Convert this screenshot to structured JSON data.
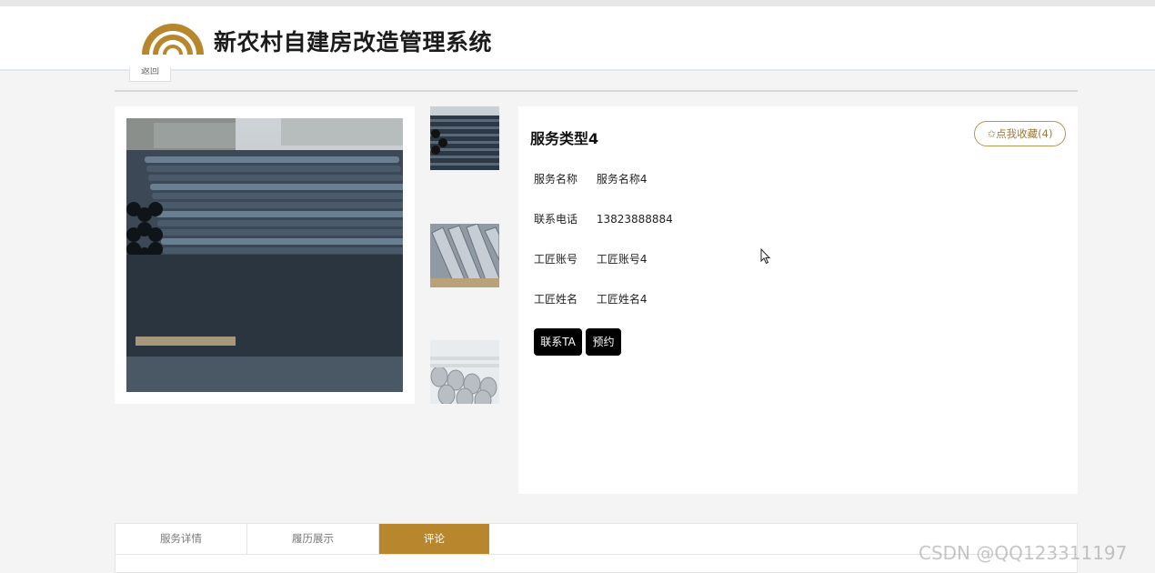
{
  "header": {
    "title": "新农村自建房改造管理系统",
    "logo_icon": "arch-logo-icon",
    "brand_color": "#b8872d"
  },
  "nav": {
    "back_label": "返回"
  },
  "gallery": {
    "main_image": "stacked-pipes-photo",
    "thumbnails": [
      "black-pipes-thumbnail",
      "steel-angle-thumbnail",
      "grey-pipes-thumbnail"
    ]
  },
  "service": {
    "title": "服务类型4",
    "favorite_label": "✩点我收藏(4)",
    "fields": [
      {
        "label": "服务名称",
        "value": "服务名称4"
      },
      {
        "label": "联系电话",
        "value": "13823888884"
      },
      {
        "label": "工匠账号",
        "value": "工匠账号4"
      },
      {
        "label": "工匠姓名",
        "value": "工匠姓名4"
      }
    ],
    "contact_button": "联系TA",
    "book_button": "预约"
  },
  "tabs": [
    {
      "label": "服务详情",
      "active": false
    },
    {
      "label": "履历展示",
      "active": false
    },
    {
      "label": "评论",
      "active": true
    }
  ],
  "watermark": "CSDN @QQ123311197"
}
